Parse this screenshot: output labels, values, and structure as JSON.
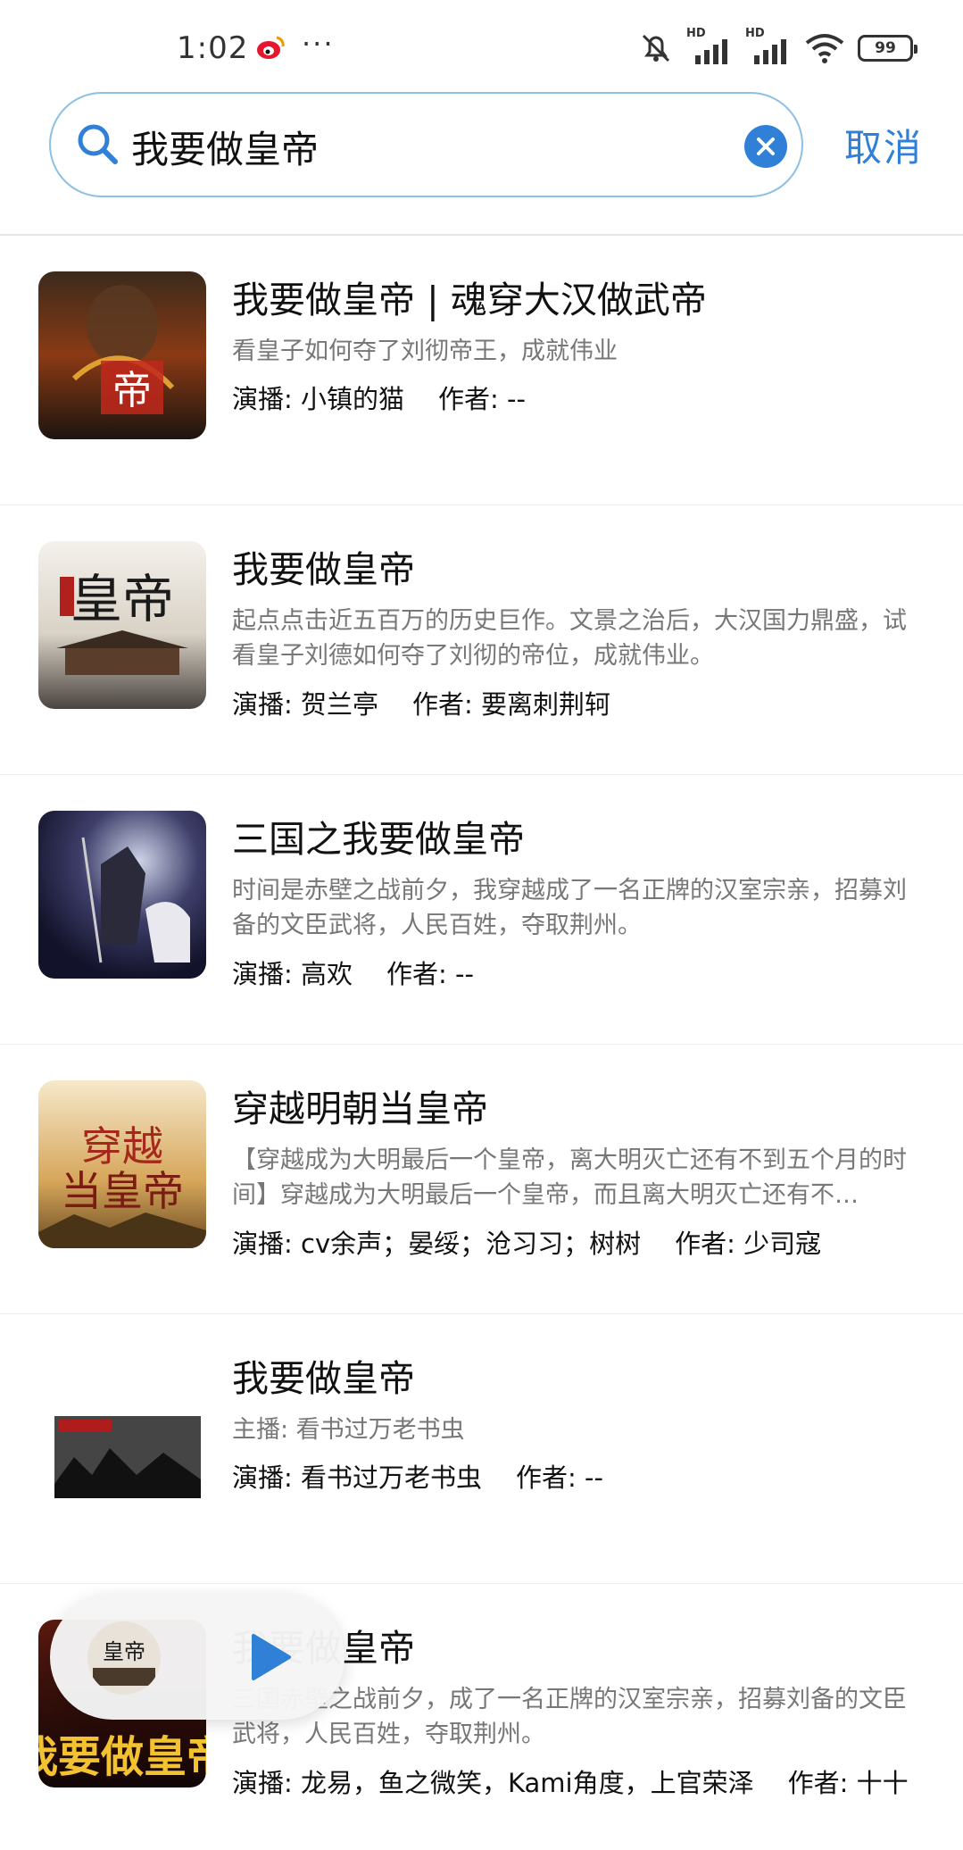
{
  "status_bar": {
    "time": "1:02",
    "dots": "···",
    "hd1": "HD",
    "hd2": "HD",
    "battery": "99",
    "icons": [
      "weibo-icon",
      "bell-muted-icon",
      "signal-icon",
      "wifi-icon",
      "battery-icon"
    ]
  },
  "search": {
    "query": "我要做皇帝",
    "placeholder": "",
    "cancel_label": "取消"
  },
  "colors": {
    "accent": "#2f80d6",
    "search_border": "#8cc0e6"
  },
  "results": [
    {
      "title": "我要做皇帝 | 魂穿大汉做武帝",
      "description": "看皇子如何夺了刘彻帝王，成就伟业",
      "anchor_label": "演播:",
      "anchor": "小镇的猫",
      "author_label": "作者:",
      "author": "--"
    },
    {
      "title": "我要做皇帝",
      "description": "起点点击近五百万的历史巨作。文景之治后，大汉国力鼎盛，试看皇子刘德如何夺了刘彻的帝位，成就伟业。",
      "anchor_label": "演播:",
      "anchor": "贺兰亭",
      "author_label": "作者:",
      "author": "要离刺荆轲"
    },
    {
      "title": "三国之我要做皇帝",
      "description": "时间是赤壁之战前夕，我穿越成了一名正牌的汉室宗亲，招募刘备的文臣武将，人民百姓，夺取荆州。",
      "anchor_label": "演播:",
      "anchor": "高欢",
      "author_label": "作者:",
      "author": "--"
    },
    {
      "title": "穿越明朝当皇帝",
      "description": "【穿越成为大明最后一个皇帝，离大明灭亡还有不到五个月的时间】穿越成为大明最后一个皇帝，而且离大明灭亡还有不…",
      "anchor_label": "演播:",
      "anchor": "cv余声；晏绥；沧习习；树树",
      "author_label": "作者:",
      "author": "少司寇"
    },
    {
      "title": "我要做皇帝",
      "description": "主播: 看书过万老书虫",
      "anchor_label": "演播:",
      "anchor": "看书过万老书虫",
      "author_label": "作者:",
      "author": "--"
    },
    {
      "title": "我要做皇帝",
      "description": "三国赤壁之战前夕，成了一名正牌的汉室宗亲，招募刘备的文臣武将，人民百姓，夺取荆州。",
      "anchor_label": "演播:",
      "anchor": "龙易，鱼之微笑，Kami角度，上官荣泽",
      "author_label": "作者:",
      "author": "十十"
    }
  ],
  "player": {
    "icons": [
      "album-art-icon",
      "play-icon"
    ]
  }
}
